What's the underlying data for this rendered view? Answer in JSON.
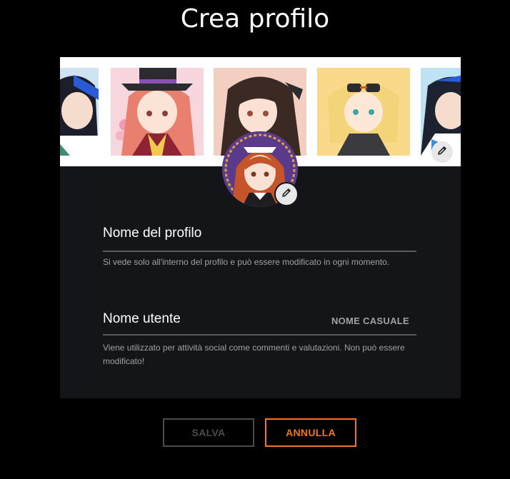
{
  "page": {
    "title": "Crea profilo"
  },
  "banner": {
    "thumbnails": [
      "banner-character-1",
      "banner-character-2",
      "banner-character-3",
      "banner-character-4",
      "banner-character-5"
    ],
    "edit_icon": "pencil-icon"
  },
  "avatar": {
    "edit_icon": "pencil-icon"
  },
  "profile_name": {
    "label": "Nome del profilo",
    "value": "",
    "help": "Si vede solo all'interno del profilo e può essere modificato in ogni momento."
  },
  "username": {
    "label": "Nome utente",
    "value": "",
    "random_label": "NOME CASUALE",
    "help": "Viene utilizzato per attività social come commenti e valutazioni. Non può essere modificato!"
  },
  "actions": {
    "save_label": "SALVA",
    "cancel_label": "ANNULLA"
  },
  "colors": {
    "accent": "#f47521",
    "background": "#000000",
    "card": "#141519",
    "disabled": "#4a4b50"
  }
}
